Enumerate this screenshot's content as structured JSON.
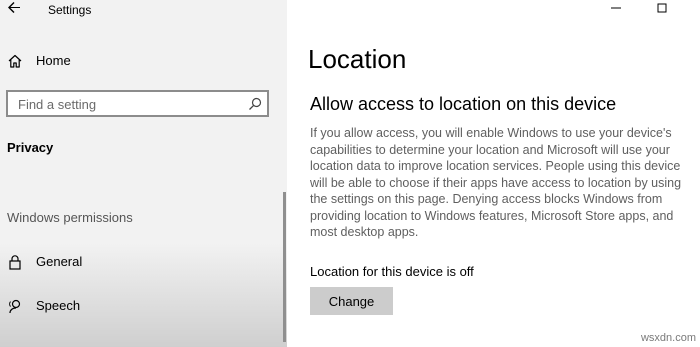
{
  "window": {
    "title": "Settings",
    "minimize_icon": "minimize-icon",
    "maximize_icon": "maximize-icon"
  },
  "sidebar": {
    "back_icon": "back-arrow-icon",
    "home_label": "Home",
    "home_icon": "home-icon",
    "search": {
      "placeholder": "Find a setting",
      "icon": "search-icon"
    },
    "section_label": "Privacy",
    "group_label": "Windows permissions",
    "items": [
      {
        "label": "General",
        "icon": "lock-icon"
      },
      {
        "label": "Speech",
        "icon": "speech-icon"
      }
    ]
  },
  "main": {
    "title": "Location",
    "heading": "Allow access to location on this device",
    "description": "If you allow access, you will enable Windows to use your device's capabilities to determine your location and Microsoft will use your location data to improve location services. People using this device will be able to choose if their apps have access to location by using the settings on this page. Denying access blocks Windows from providing location to Windows features, Microsoft Store apps, and most desktop apps.",
    "status": "Location for this device is off",
    "change_button": "Change"
  },
  "watermark": "wsxdn.com",
  "colors": {
    "sidebar_bg": "#f2f2f2",
    "button_bg": "#cccccc",
    "body_text": "#5f5f5f"
  }
}
